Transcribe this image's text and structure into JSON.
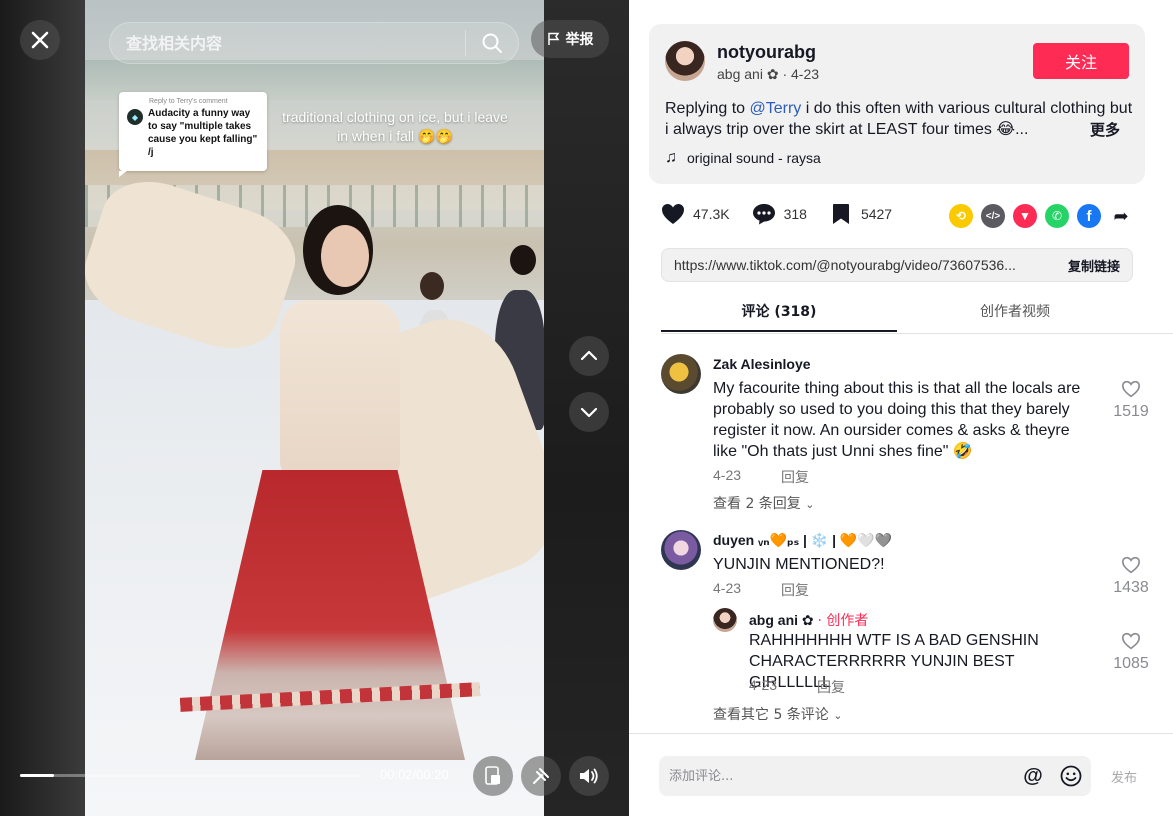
{
  "video": {
    "search_placeholder": "查找相关内容",
    "report_label": "举报",
    "overlay_comment": {
      "reply_label": "Reply to Terry's comment",
      "text": "Audacity a funny way to say \"multiple takes cause you kept falling\" /j"
    },
    "caption_overlay": "traditional clothing on ice, but i leave in when i fall 🤭🤭",
    "time": "00:02/00:20",
    "progress": 0.1
  },
  "author": {
    "handle": "notyourabg",
    "nickname": "abg  ani ✿",
    "date": "4-23",
    "follow_label": "关注",
    "desc_prefix": "Replying to ",
    "desc_mention": "@Terry",
    "desc_text": " i do this often with various cultural clothing but i always trip over the skirt at LEAST four times 😂...",
    "more_label": "更多",
    "music": "original sound - raysa"
  },
  "stats": {
    "likes": "47.3K",
    "comments": "318",
    "saves": "5427"
  },
  "share": [
    "repost-icon",
    "embed-icon",
    "send-icon",
    "whatsapp-icon",
    "facebook-icon",
    "share-arrow-icon"
  ],
  "link": {
    "url": "https://www.tiktok.com/@notyourabg/video/73607536...",
    "copy_label": "复制链接"
  },
  "tabs": [
    "评论 (318)",
    "创作者视频"
  ],
  "comments": [
    {
      "name": "Zak Alesinloye",
      "text": "My facourite thing about this is that all the locals are probably so used to you doing this that they barely register it now. An oursider comes & asks & theyre like \"Oh thats just Unni shes fine\" 🤣",
      "date": "4-23",
      "reply_label": "回复",
      "likes": "1519",
      "view_replies": "查看 2 条回复"
    },
    {
      "name": "duyen ᵥₙ🧡ₚₛ | ❄️ | 🧡🤍🩶",
      "text": "YUNJIN MENTIONED?!",
      "date": "4-23",
      "reply_label": "回复",
      "likes": "1438"
    },
    {
      "name": "abg  ani ✿",
      "creator_tag": "· 创作者",
      "text": "RAHHHHHHH WTF IS A BAD GENSHIN CHARACTERRRRRR YUNJIN BEST GIRLLLLLL",
      "date": "4-23",
      "reply_label": "回复",
      "likes": "1085",
      "view_more": "查看其它 5 条评论"
    }
  ],
  "comment_input": {
    "placeholder": "添加评论...",
    "post_label": "发布"
  },
  "colors": {
    "accent": "#fe2c55",
    "mention": "#2b5db9"
  }
}
